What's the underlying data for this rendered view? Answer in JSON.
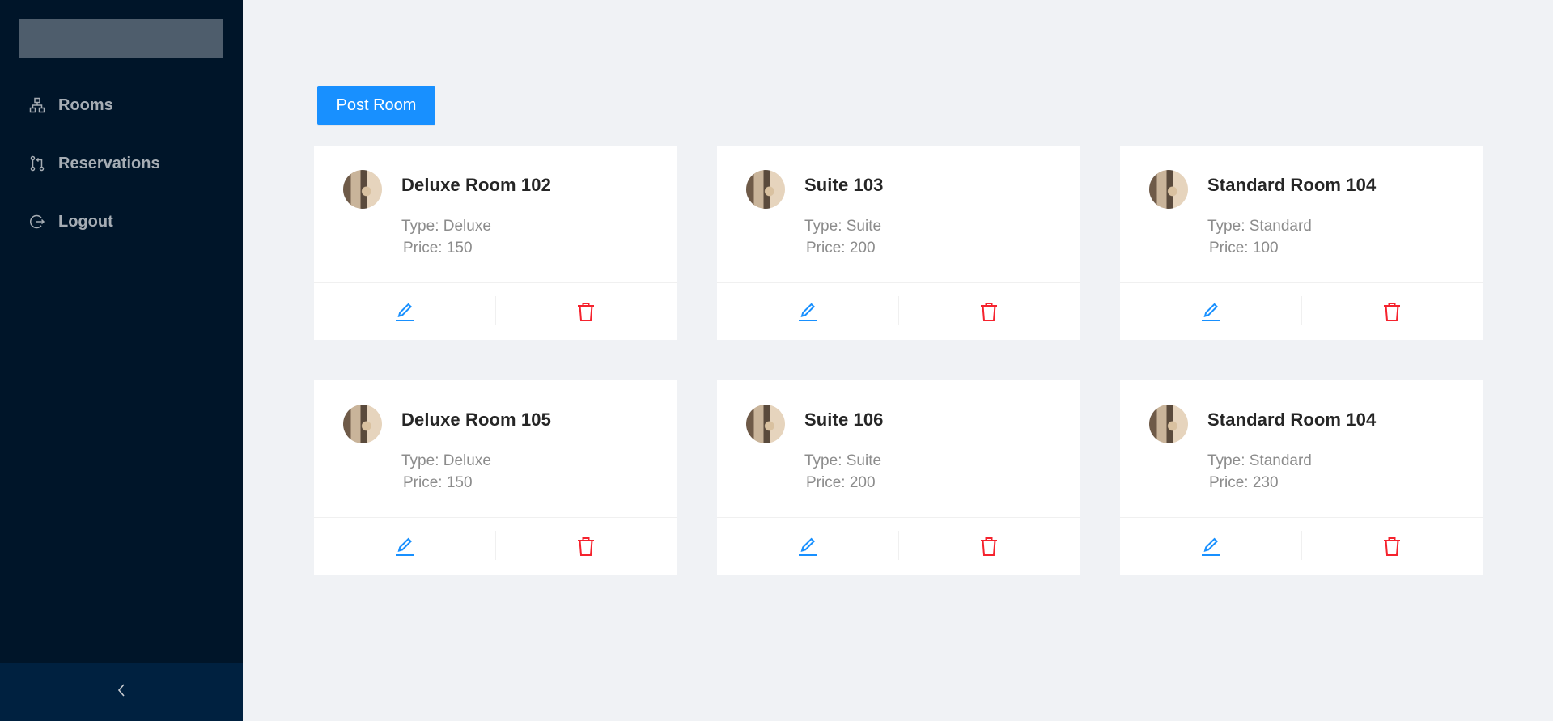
{
  "sidebar": {
    "items": [
      {
        "label": "Rooms",
        "icon": "cluster-icon"
      },
      {
        "label": "Reservations",
        "icon": "pull-request-icon"
      },
      {
        "label": "Logout",
        "icon": "logout-icon"
      }
    ],
    "collapse_icon": "chevron-left-icon"
  },
  "toolbar": {
    "post_label": "Post Room"
  },
  "rooms": [
    {
      "title": "Deluxe Room 102",
      "type": "Type: Deluxe",
      "price": "Price: 150"
    },
    {
      "title": "Suite 103",
      "type": "Type: Suite",
      "price": "Price: 200"
    },
    {
      "title": "Standard Room 104",
      "type": "Type: Standard",
      "price": "Price: 100"
    },
    {
      "title": "Deluxe Room 105",
      "type": "Type: Deluxe",
      "price": "Price: 150"
    },
    {
      "title": "Suite 106",
      "type": "Type: Suite",
      "price": "Price: 200"
    },
    {
      "title": "Standard Room 104",
      "type": "Type: Standard",
      "price": "Price: 230"
    }
  ],
  "colors": {
    "sidebar_bg": "#001529",
    "primary": "#1890ff",
    "danger": "#f5222d",
    "page_bg": "#f0f2f5"
  }
}
